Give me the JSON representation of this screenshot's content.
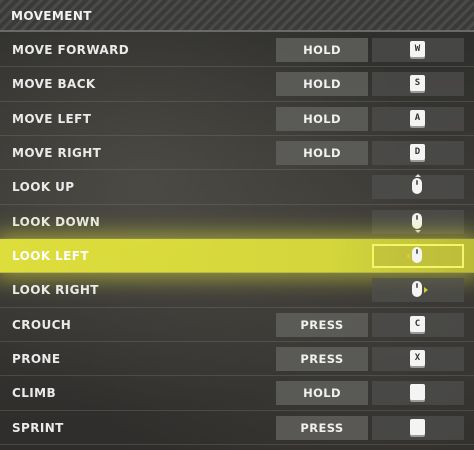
{
  "header": {
    "title": "MOVEMENT"
  },
  "rows": [
    {
      "label": "MOVE FORWARD",
      "mode": "HOLD",
      "key": "W",
      "key_icon": "keycap"
    },
    {
      "label": "MOVE BACK",
      "mode": "HOLD",
      "key": "S",
      "key_icon": "keycap"
    },
    {
      "label": "MOVE LEFT",
      "mode": "HOLD",
      "key": "A",
      "key_icon": "keycap"
    },
    {
      "label": "MOVE RIGHT",
      "mode": "HOLD",
      "key": "D",
      "key_icon": "keycap"
    },
    {
      "label": "LOOK UP",
      "mode": "",
      "key": "",
      "key_icon": "mouse-up-icon"
    },
    {
      "label": "LOOK DOWN",
      "mode": "",
      "key": "",
      "key_icon": "mouse-down-icon"
    },
    {
      "label": "LOOK LEFT",
      "mode": "",
      "key": "",
      "key_icon": "mouse-left-icon",
      "selected": true
    },
    {
      "label": "LOOK RIGHT",
      "mode": "",
      "key": "",
      "key_icon": "mouse-right-icon"
    },
    {
      "label": "CROUCH",
      "mode": "PRESS",
      "key": "C",
      "key_icon": "keycap"
    },
    {
      "label": "PRONE",
      "mode": "PRESS",
      "key": "X",
      "key_icon": "keycap"
    },
    {
      "label": "CLIMB",
      "mode": "HOLD",
      "key": "",
      "key_icon": "blank-keycap"
    },
    {
      "label": "SPRINT",
      "mode": "PRESS",
      "key": "",
      "key_icon": "blank-keycap"
    }
  ],
  "colors": {
    "highlight": "#e6e63c",
    "mode_bg": "#5f5f5c",
    "keycap": "#f4f4f4"
  }
}
